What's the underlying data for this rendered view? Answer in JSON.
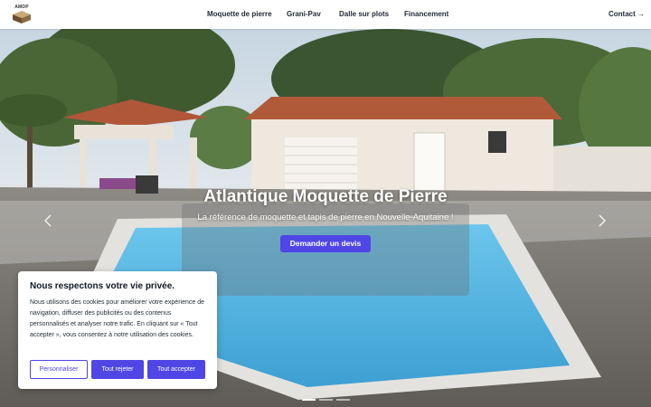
{
  "brand": {
    "logo_text": "AMDP"
  },
  "nav": {
    "items": [
      {
        "label": "Moquette de pierre"
      },
      {
        "label": "Grani-Pav"
      },
      {
        "label": "Dalle sur plots"
      },
      {
        "label": "Financement"
      }
    ],
    "contact_label": "Contact →"
  },
  "hero": {
    "title": "Atlantique Moquette de Pierre",
    "subtitle": "La référence de moquette et tapis de pierre en Nouvelle-Aquitaine !",
    "cta_label": "Demander un devis",
    "slides_total": 3,
    "active_slide": 1
  },
  "cookie": {
    "title": "Nous respectons votre vie privée.",
    "text": "Nous utilisons des cookies pour améliorer votre expérience de navigation, diffuser des publicités ou des contenus personnalisés et analyser notre trafic. En cliquant sur « Tout accepter », vous consentez à notre utilisation des cookies.",
    "customize_label": "Personnaliser",
    "reject_label": "Tout rejeter",
    "accept_label": "Tout accepter"
  },
  "colors": {
    "accent": "#4f46e5",
    "header_bg": "#ffffff",
    "pool_water": "#4fb3e0"
  },
  "icons": {
    "prev": "chevron-left-icon",
    "next": "chevron-right-icon"
  }
}
